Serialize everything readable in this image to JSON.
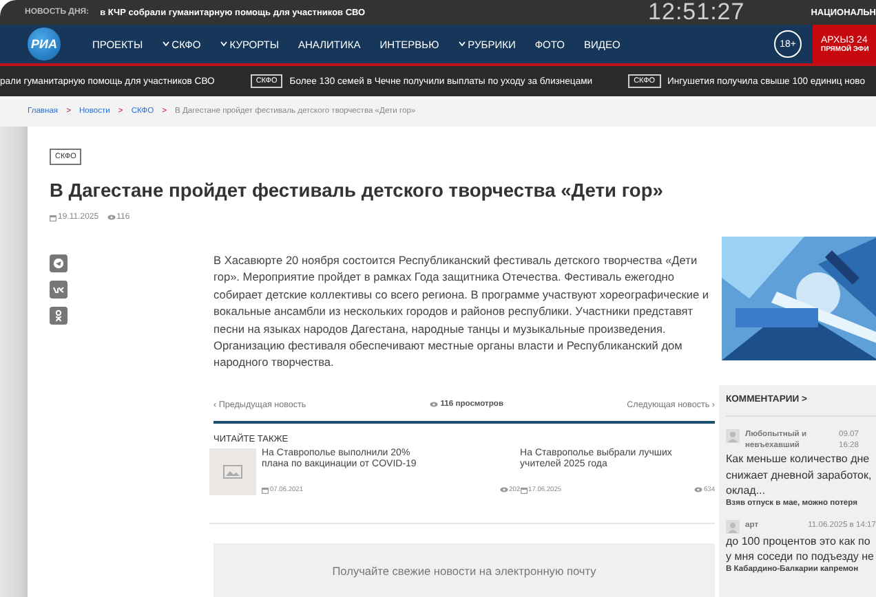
{
  "top_bar": {
    "label": "НОВОСТЬ ДНЯ:",
    "headline": "в КЧР собрали гуманитарную помощь для участников СВО",
    "clock": "12:51:27",
    "right_text": "НАЦИОНАЛЬН"
  },
  "nav": {
    "logo": "РИА",
    "items": [
      {
        "label": "ПРОЕКТЫ",
        "has_menu": false
      },
      {
        "label": "СКФО",
        "has_menu": true
      },
      {
        "label": "КУРОРТЫ",
        "has_menu": true
      },
      {
        "label": "АНАЛИТИКА",
        "has_menu": false
      },
      {
        "label": "ИНТЕРВЬЮ",
        "has_menu": false
      },
      {
        "label": "РУБРИКИ",
        "has_menu": true
      },
      {
        "label": "ФОТО",
        "has_menu": false
      },
      {
        "label": "ВИДЕО",
        "has_menu": false
      }
    ],
    "age": "18+",
    "live": {
      "title": "АРХЫЗ 24",
      "subtitle": "ПРЯМОЙ ЭФИ"
    }
  },
  "ticker": [
    {
      "text": "рали гуманитарную помощь для участников СВО"
    },
    {
      "tag": "СКФО",
      "text": "Более 130 семей в Чечне получили выплаты по уходу за близнецами"
    },
    {
      "tag": "СКФО",
      "text": "Ингушетия получила свыше 100 единиц ново"
    }
  ],
  "breadcrumbs": {
    "separator": ">",
    "items": [
      "Главная",
      "Новости",
      "СКФО"
    ],
    "current": "В Дагестане пройдет фестиваль детского творчества «Дети гор»"
  },
  "article": {
    "tag": "СКФО",
    "title": "В Дагестане пройдет фестиваль детского творчества «Дети гор»",
    "date": "19.11.2025",
    "views": "116",
    "body": "В Хасавюрте 20 ноября состоится Республиканский фестиваль детского творчества «Дети гор». Мероприятие пройдет в рамках Года защитника Отечества. Фестиваль ежегодно собирает детские коллективы со всего региона. В программе участвуют хореографические и вокальные ансамбли из нескольких городов и районов республики. Участники представят песни на языках народов Дагестана, народные танцы и музыкальные произведения. Организацию фестиваля обеспечивают местные органы власти и Республиканский дом народного творчества.",
    "prev": "‹ Предыдущая новость",
    "views_label": "116 просмотров",
    "next": "Следующая новость ›",
    "read_also": {
      "heading": "ЧИТАЙТЕ ТАКЖЕ",
      "items": [
        {
          "title": "На Ставрополье выполнили 20% плана по вакцинации от COVID-19",
          "date": "07.06.2021",
          "views": "202",
          "has_image": true
        },
        {
          "title": "На Ставрополье выбрали лучших учителей 2025 года",
          "date": "17.06.2025",
          "views": "634",
          "has_image": false
        }
      ]
    },
    "subscribe": "Получайте свежие новости на электронную почту"
  },
  "sidebar": {
    "comments_heading": "КОММЕНТАРИИ >",
    "comments": [
      {
        "author": "Любопытный и невъехавший",
        "date": "09.07",
        "time": "16:28",
        "lines": [
          "Как меньше количество дне",
          "снижает дневной заработок,",
          "оклад..."
        ],
        "article": "Взяв отпуск в мае, можно потеря"
      },
      {
        "author": "арт",
        "date": "11.06.2025 в 14:17",
        "lines": [
          "до 100 процентов это как по",
          "у мня соседи по подъезду не"
        ],
        "article": "В Кабардино-Балкарии капремон"
      }
    ]
  }
}
